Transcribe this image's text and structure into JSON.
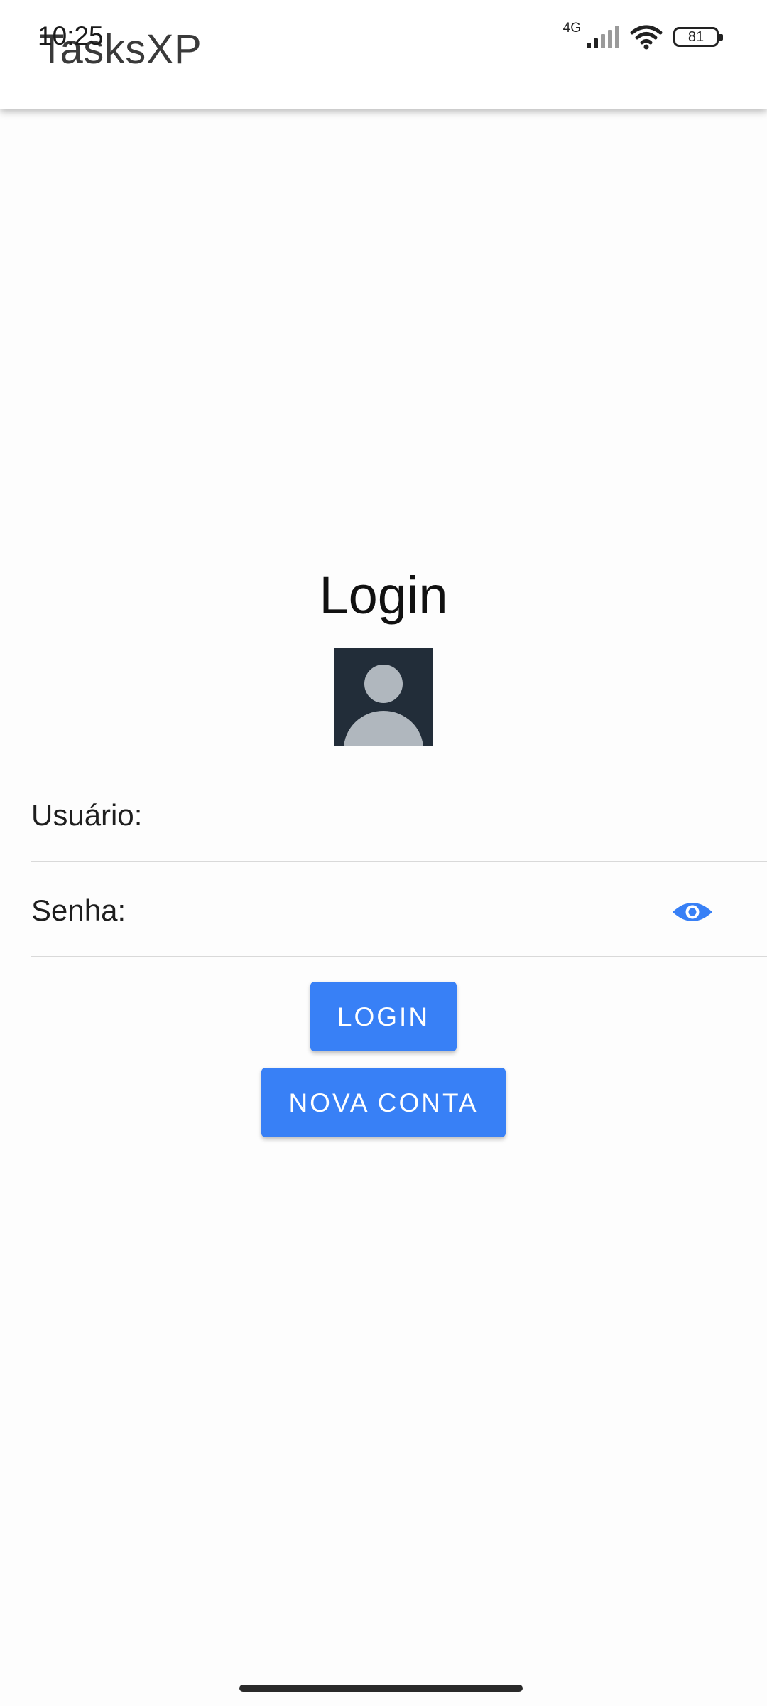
{
  "status_bar": {
    "time": "10:25",
    "network": "4G",
    "battery": "81"
  },
  "app_bar": {
    "title": "TasksXP"
  },
  "login": {
    "title": "Login",
    "avatar_icon": "user-avatar-icon"
  },
  "form": {
    "usuario_label": "Usuário:",
    "usuario_value": "",
    "senha_label": "Senha:",
    "senha_value": "",
    "password_toggle_icon": "eye-icon"
  },
  "buttons": {
    "login_label": "LOGIN",
    "nova_conta_label": "NOVA CONTA"
  },
  "colors": {
    "primary": "#3880f6",
    "avatar_bg": "#222d39",
    "avatar_fg": "#b0b7be"
  }
}
